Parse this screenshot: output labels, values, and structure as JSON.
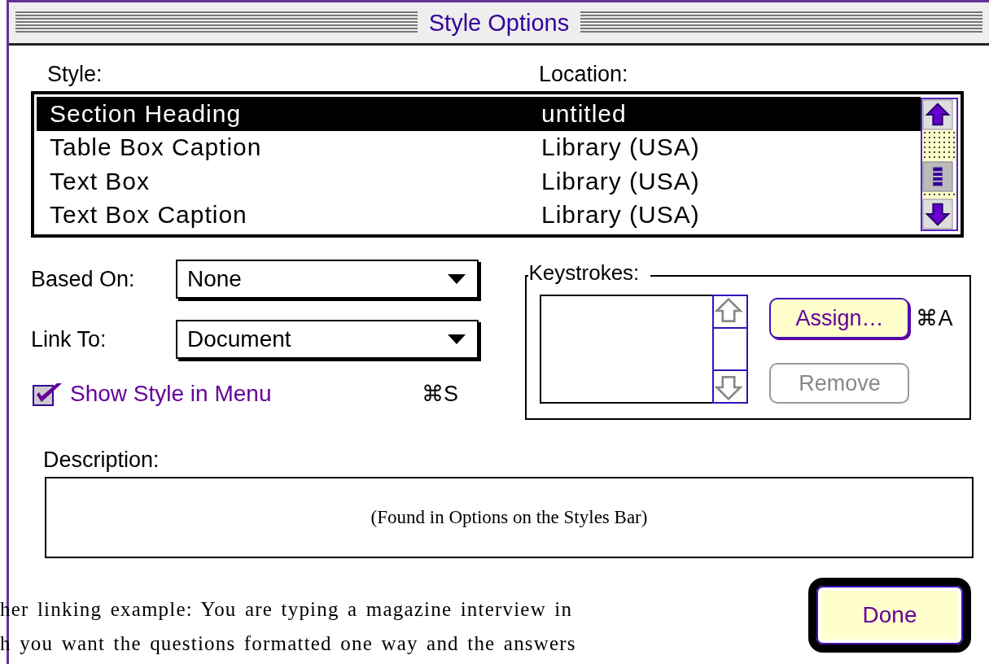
{
  "window": {
    "title": "Style Options"
  },
  "style_list": {
    "columns": [
      "Style:",
      "Location:"
    ],
    "rows": [
      {
        "style": "Section Heading",
        "location": "untitled",
        "selected": true
      },
      {
        "style": "Table Box Caption",
        "location": "Library (USA)",
        "selected": false
      },
      {
        "style": "Text Box",
        "location": "Library (USA)",
        "selected": false
      },
      {
        "style": "Text Box Caption",
        "location": "Library (USA)",
        "selected": false
      }
    ]
  },
  "based_on": {
    "label": "Based On:",
    "value": "None"
  },
  "link_to": {
    "label": "Link To:",
    "value": "Document"
  },
  "show_in_menu": {
    "label": "Show Style in Menu",
    "checked": true,
    "shortcut": "⌘S"
  },
  "keystrokes": {
    "title": "Keystrokes:",
    "shortcut": "⌘A",
    "buttons": [
      {
        "label": "Assign…",
        "disabled": false
      },
      {
        "label": "Remove",
        "disabled": true
      }
    ]
  },
  "description": {
    "label": "Description:",
    "text": "(Found in Options on the Styles Bar)"
  },
  "done_button": {
    "label": "Done",
    "default": true
  },
  "background_text": {
    "lines": [
      "her linking example: You are typing a magazine interview in",
      "h you want the questions formatted one way and the answers"
    ]
  }
}
